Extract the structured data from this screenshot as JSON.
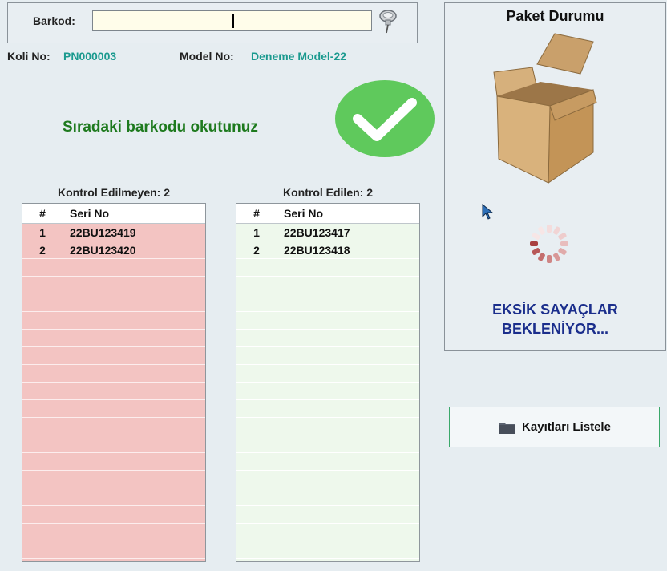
{
  "barkod": {
    "label": "Barkod:",
    "value": ""
  },
  "info": {
    "koli_label": "Koli No:",
    "koli_value": "PN000003",
    "model_label": "Model No:",
    "model_value": "Deneme Model-22"
  },
  "prompt": "Sıradaki barkodu okutunuz",
  "left_panel": {
    "caption": "Kontrol Edilmeyen: 2",
    "columns": [
      "#",
      "Seri No"
    ],
    "rows": [
      [
        "1",
        "22BU123419"
      ],
      [
        "2",
        "22BU123420"
      ]
    ]
  },
  "right_panel": {
    "caption": "Kontrol Edilen: 2",
    "columns": [
      "#",
      "Seri No"
    ],
    "rows": [
      [
        "1",
        "22BU123417"
      ],
      [
        "2",
        "22BU123418"
      ]
    ]
  },
  "paket": {
    "title": "Paket Durumu",
    "status_line1": "EKSİK SAYAÇLAR",
    "status_line2": "BEKLENİYOR..."
  },
  "button": {
    "label": "Kayıtları Listele"
  },
  "icons": {
    "pin": "pushpin-icon",
    "check": "check-circle-icon",
    "box": "open-box-icon",
    "spinner": "loading-spinner-icon",
    "cursor": "mouse-cursor-icon",
    "folder": "folder-icon"
  },
  "colors": {
    "check_green": "#5fc95c",
    "teal_value": "#1b9a8f",
    "prompt_green": "#1e7a1e",
    "status_blue": "#1b2e8c",
    "unchecked_bg": "#f3c4c2",
    "checked_bg": "#eef8ec"
  }
}
